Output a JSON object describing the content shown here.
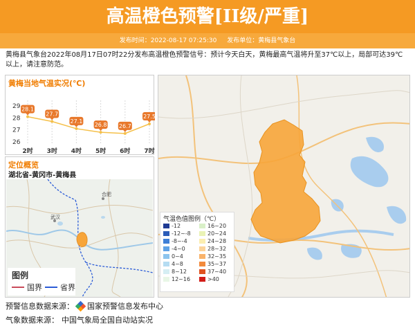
{
  "header": {
    "title": "高温橙色预警[II级/严重]",
    "publish_time": "发布时间：2022-08-17 07:25:30",
    "publisher": "发布单位：黄梅县气象台"
  },
  "description": "黄梅县气象台2022年08月17日07时22分发布高温橙色预警信号：预计今天白天，黄梅最高气温将升至37℃以上，局部可达39℃以上，请注意防范。",
  "temp_panel": {
    "title": "黄梅当地气温实况(℃)"
  },
  "chart_data": {
    "type": "line",
    "title": "黄梅当地气温实况(℃)",
    "categories": [
      "2时",
      "3时",
      "4时",
      "5时",
      "6时",
      "7时"
    ],
    "values": [
      28.1,
      27.7,
      27.1,
      26.8,
      26.7,
      27.5
    ],
    "yticks": [
      "29",
      "28",
      "27",
      "26"
    ],
    "ylim": [
      26,
      29
    ],
    "grid": "vertical-dashed",
    "line_color": "#f5c04a",
    "label_color": "#e8782b"
  },
  "location": {
    "title": "定位概览",
    "path": "湖北省-黄冈市-黄梅县",
    "map_labels": {
      "city1": "合肥",
      "city2": "武汉"
    },
    "legend_title": "图例",
    "legend_items": [
      {
        "label": "国界",
        "color": "#c94a5a"
      },
      {
        "label": "省界",
        "color": "#2a5bd7"
      }
    ]
  },
  "main_map": {
    "legend_title": "气温色值图例（℃）",
    "legend_items": [
      {
        "label": "-12",
        "color": "#1f3a93"
      },
      {
        "label": "16~20",
        "color": "#d9f0c8"
      },
      {
        "label": "-12~-8",
        "color": "#2b5cb8"
      },
      {
        "label": "20~24",
        "color": "#eaf3b5"
      },
      {
        "label": "-8~-4",
        "color": "#3f7fd6"
      },
      {
        "label": "24~28",
        "color": "#fbeeb0"
      },
      {
        "label": "-4~0",
        "color": "#5fa2e6"
      },
      {
        "label": "28~32",
        "color": "#fbd39a"
      },
      {
        "label": "0~4",
        "color": "#8cc4ee"
      },
      {
        "label": "32~35",
        "color": "#f9b36a"
      },
      {
        "label": "4~8",
        "color": "#b5dcf2"
      },
      {
        "label": "35~37",
        "color": "#f28a3c"
      },
      {
        "label": "8~12",
        "color": "#d5eef3"
      },
      {
        "label": "37~40",
        "color": "#e0521f"
      },
      {
        "label": "12~16",
        "color": "#e8f6e6"
      },
      {
        "label": ">40",
        "color": "#d21d18"
      }
    ],
    "area_color": "#f7a53a"
  },
  "footer": {
    "warning_source_label": "预警信息数据来源：",
    "warning_source": "国家预警信息发布中心",
    "weather_source_label": "气象数据来源：",
    "weather_source": "中国气象局全国自动站实况"
  }
}
